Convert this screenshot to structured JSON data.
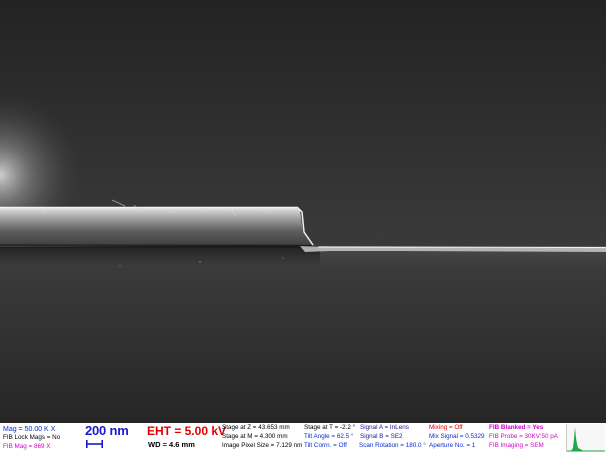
{
  "sem": {
    "mag": "Mag =  50.00 K X",
    "fib_lock_mags": "FIB Lock Mags = No",
    "fib_mag": "FIB Mag =   869 X",
    "scalebar": "200 nm",
    "eht": "EHT = 5.00 kV",
    "wd": "WD = 4.6 mm",
    "stage_z": "Stage at Z = 43.653 mm",
    "stage_m": "Stage at M =  4.300 mm",
    "pixel_size": "Image Pixel Size = 7.129 nm",
    "stage_t": "Stage at T =  -2.2 °",
    "tilt_angle": "Tilt Angle =  62.5 °",
    "tilt_corrn": "Tilt Corrn. = Off",
    "signal_a": "Signal A = InLens",
    "signal_b": "Signal B = SE2",
    "scan_rotation": "Scan Rotation = 180.0 °",
    "mixing": "Mixing = Off",
    "mix_signal": "Mix Signal = 0.5329",
    "aperture": "Aperture No. = 1",
    "fib_blanked": "FIB Blanked = Yes",
    "fib_probe": "FIB Probe = 30KV:50 pA",
    "fib_imaging": "FIB Imaging = SEM"
  },
  "colors": {
    "blue": "#0a2bd0",
    "red": "#e00000",
    "magenta": "#d300c8",
    "histogram_green": "#1fa84a"
  }
}
